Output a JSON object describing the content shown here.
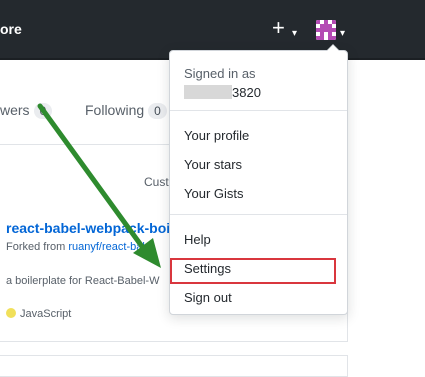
{
  "header": {
    "nav_fragment": "ore",
    "plus_icon": "plus-icon",
    "caret_icon": "caret-down-icon",
    "avatar_icon": "avatar-icon"
  },
  "profile_tabs": {
    "followers_fragment": "wers",
    "followers_count": "0",
    "following_label": "Following",
    "following_count": "0"
  },
  "repo_list": {
    "customize_fragment": "Cust",
    "repo_title": "react-babel-webpack-boil",
    "forked_prefix": "Forked from ",
    "forked_link": "ruanyf/react-babe",
    "description": "a boilerplate for React-Babel-W",
    "language": "JavaScript",
    "language_color": "#f1e05a"
  },
  "dropdown": {
    "signed_in_as": "Signed in as",
    "username_suffix": "3820",
    "items": [
      "Your profile",
      "Your stars",
      "Your Gists",
      "Help",
      "Settings",
      "Sign out"
    ],
    "highlight_color": "#d9363e"
  },
  "annotation": {
    "arrow_color": "#2e8b2e"
  }
}
